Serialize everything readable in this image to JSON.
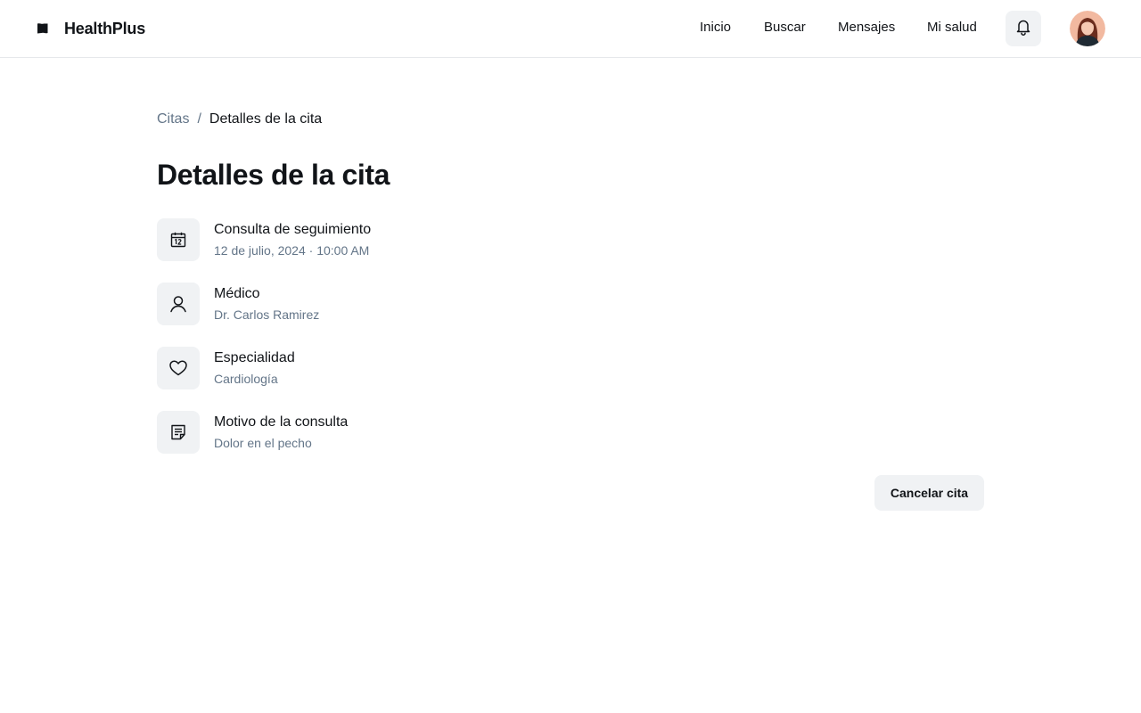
{
  "app": {
    "name": "HealthPlus",
    "logo_icon": "flag-icon"
  },
  "nav": {
    "items": [
      {
        "label": "Inicio"
      },
      {
        "label": "Buscar"
      },
      {
        "label": "Mensajes"
      },
      {
        "label": "Mi salud"
      }
    ],
    "notifications_icon": "bell-icon"
  },
  "breadcrumb": {
    "parent": "Citas",
    "separator": "/",
    "current": "Detalles de la cita"
  },
  "page": {
    "title": "Detalles de la cita"
  },
  "details": [
    {
      "icon": "calendar-icon",
      "label": "Consulta de seguimiento",
      "value": "12 de julio, 2024 · 10:00 AM"
    },
    {
      "icon": "user-icon",
      "label": "Médico",
      "value": "Dr. Carlos Ramirez"
    },
    {
      "icon": "heart-icon",
      "label": "Especialidad",
      "value": "Cardiología"
    },
    {
      "icon": "note-icon",
      "label": "Motivo de la consulta",
      "value": "Dolor en el pecho"
    }
  ],
  "actions": {
    "cancel_label": "Cancelar cita"
  },
  "colors": {
    "text_primary": "#111418",
    "text_secondary": "#637588",
    "surface": "#f0f2f4",
    "border": "#e6e8eb"
  }
}
